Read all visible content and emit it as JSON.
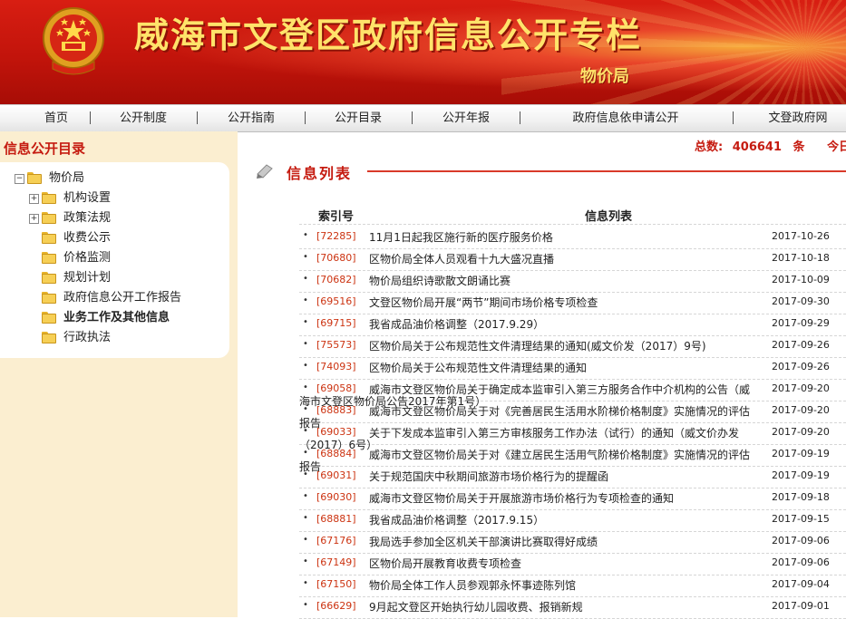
{
  "header": {
    "site_title": "威海市文登区政府信息公开专栏",
    "dept_name": "物价局"
  },
  "nav": [
    "首页",
    "公开制度",
    "公开指南",
    "公开目录",
    "公开年报",
    "政府信息依申请公开",
    "文登政府网"
  ],
  "sidebar": {
    "title": "信息公开目录",
    "root": "物价局",
    "items": [
      {
        "label": "机构设置",
        "expandable": true
      },
      {
        "label": "政策法规",
        "expandable": true
      },
      {
        "label": "收费公示",
        "expandable": false
      },
      {
        "label": "价格监测",
        "expandable": false
      },
      {
        "label": "规划计划",
        "expandable": false
      },
      {
        "label": "政府信息公开工作报告",
        "expandable": false
      },
      {
        "label": "业务工作及其他信息",
        "expandable": false,
        "active": true
      },
      {
        "label": "行政执法",
        "expandable": false
      }
    ]
  },
  "stats": {
    "total_label": "总数:",
    "total_value": "406641",
    "unit": "条",
    "today_label": "今日公开"
  },
  "list": {
    "heading": "信息列表",
    "col_index": "索引号",
    "col_title": "信息列表",
    "rows": [
      {
        "index": "[72285]",
        "title": "11月1日起我区施行新的医疗服务价格",
        "date": "2017-10-26"
      },
      {
        "index": "[70680]",
        "title": "区物价局全体人员观看十九大盛况直播",
        "date": "2017-10-18"
      },
      {
        "index": "[70682]",
        "title": "物价局组织诗歌散文朗诵比赛",
        "date": "2017-10-09"
      },
      {
        "index": "[69516]",
        "title": "文登区物价局开展“两节”期间市场价格专项检查",
        "date": "2017-09-30"
      },
      {
        "index": "[69715]",
        "title": "我省成品油价格调整（2017.9.29）",
        "date": "2017-09-29"
      },
      {
        "index": "[75573]",
        "title": "区物价局关于公布规范性文件清理结果的通知(威文价发（2017）9号)",
        "date": "2017-09-26"
      },
      {
        "index": "[74093]",
        "title": "区物价局关于公布规范性文件清理结果的通知",
        "date": "2017-09-26"
      },
      {
        "index": "[69058]",
        "title": "威海市文登区物价局关于确定成本监审引入第三方服务合作中介机构的公告（威",
        "title2": "海市文登区物价局公告2017年第1号）",
        "date": "2017-09-20"
      },
      {
        "index": "[68883]",
        "title": "威海市文登区物价局关于对《完善居民生活用水阶梯价格制度》实施情况的评估",
        "title2": "报告",
        "date": "2017-09-20"
      },
      {
        "index": "[69033]",
        "title": "关于下发成本监审引入第三方审核服务工作办法（试行）的通知（威文价办发",
        "title2": "（2017）6号）",
        "date": "2017-09-20"
      },
      {
        "index": "[68884]",
        "title": "威海市文登区物价局关于对《建立居民生活用气阶梯价格制度》实施情况的评估",
        "title2": "报告",
        "date": "2017-09-19"
      },
      {
        "index": "[69031]",
        "title": " 关于规范国庆中秋期间旅游市场价格行为的提醒函",
        "date": "2017-09-19"
      },
      {
        "index": "[69030]",
        "title": "威海市文登区物价局关于开展旅游市场价格行为专项检查的通知",
        "date": "2017-09-18"
      },
      {
        "index": "[68881]",
        "title": "我省成品油价格调整（2017.9.15）",
        "date": "2017-09-15"
      },
      {
        "index": "[67176]",
        "title": "我局选手参加全区机关干部演讲比赛取得好成绩",
        "date": "2017-09-06"
      },
      {
        "index": "[67149]",
        "title": "区物价局开展教育收费专项检查",
        "date": "2017-09-06"
      },
      {
        "index": "[67150]",
        "title": "物价局全体工作人员参观郭永怀事迹陈列馆",
        "date": "2017-09-04"
      },
      {
        "index": "[66629]",
        "title": "9月起文登区开始执行幼儿园收费、报销新规",
        "date": "2017-09-01"
      }
    ]
  },
  "colors": {
    "brand_red": "#c51b10",
    "title_gold": "#ffe36a",
    "sidebar_bg": "#fbeed0",
    "index_red": "#cc3311"
  }
}
